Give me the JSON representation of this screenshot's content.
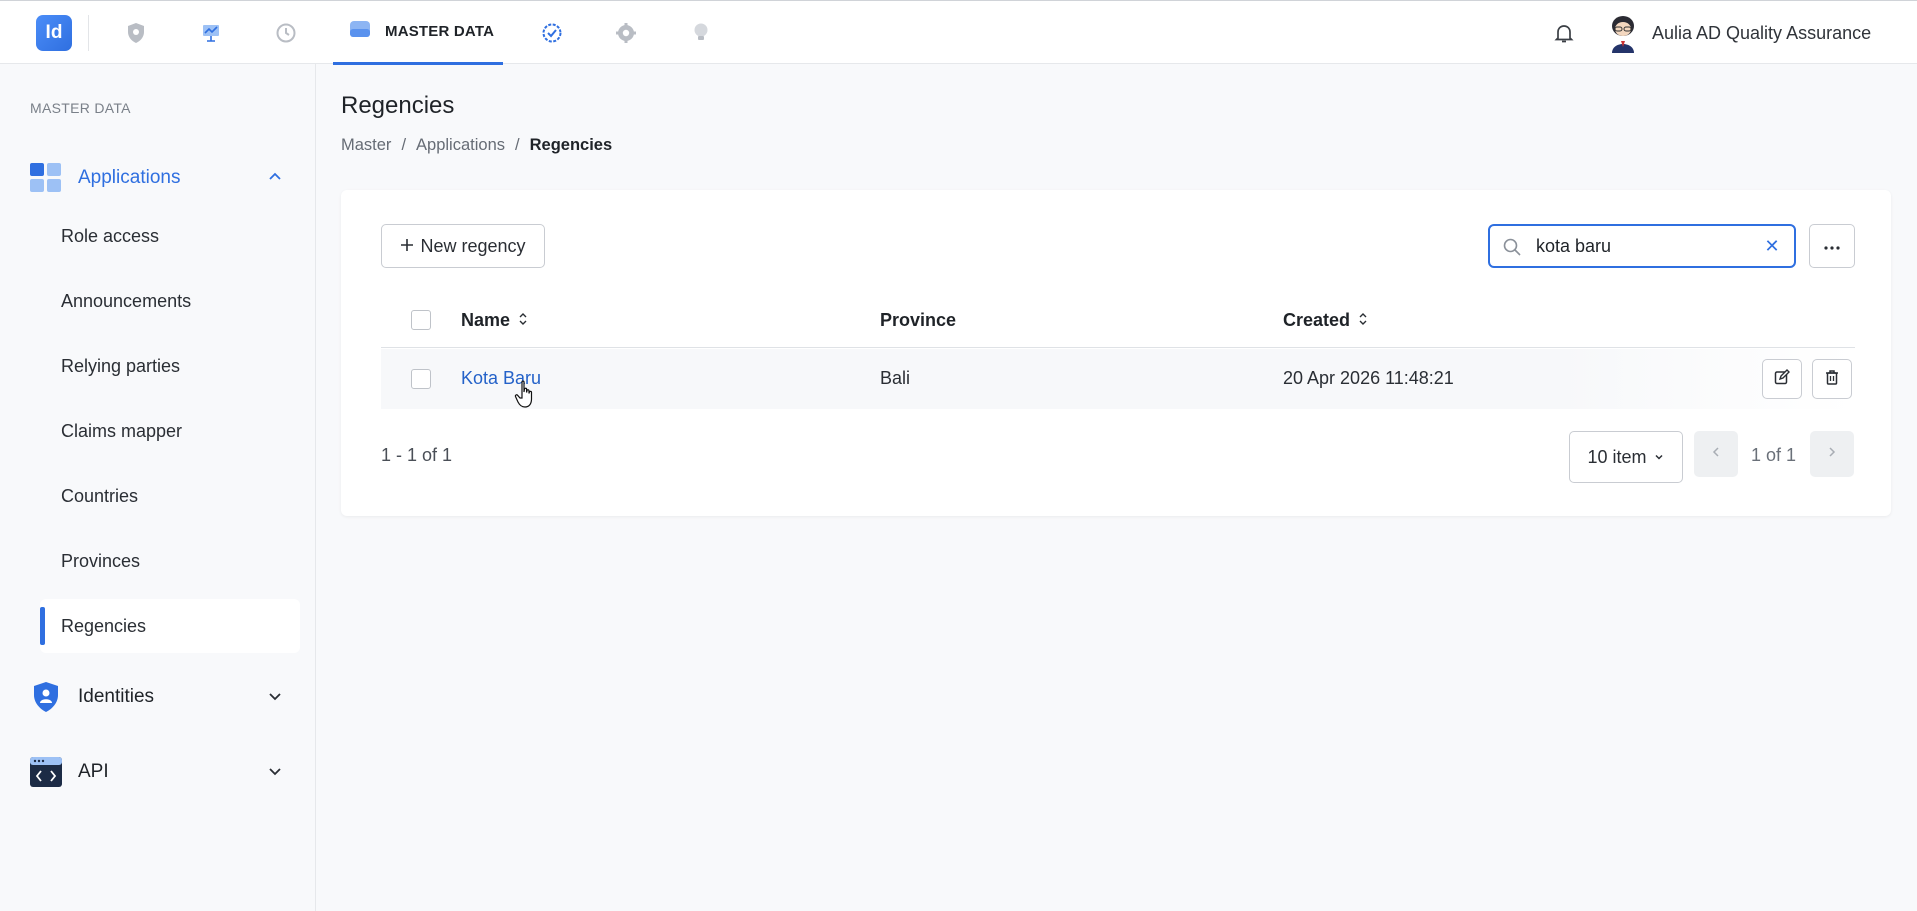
{
  "app": {
    "logo_text": "Id",
    "active_module": "MASTER DATA",
    "user_name": "Aulia AD Quality Assurance"
  },
  "topnav": {
    "icons": [
      "shield-icon",
      "dashboard-chart-icon",
      "history-clock-icon",
      "database-icon",
      "check-badge-icon",
      "gear-icon",
      "lightbulb-icon"
    ]
  },
  "sidebar": {
    "section_title": "MASTER DATA",
    "groups": [
      {
        "label": "Applications",
        "icon": "applications-grid-icon",
        "expanded": true
      },
      {
        "label": "Identities",
        "icon": "identity-shield-icon",
        "expanded": false
      },
      {
        "label": "API",
        "icon": "api-code-icon",
        "expanded": false
      }
    ],
    "items": [
      "Role access",
      "Announcements",
      "Relying parties",
      "Claims mapper",
      "Countries",
      "Provinces",
      "Regencies"
    ],
    "active_item": "Regencies"
  },
  "page": {
    "title": "Regencies",
    "breadcrumb": [
      "Master",
      "Applications",
      "Regencies"
    ]
  },
  "toolbar": {
    "new_label": "New regency",
    "search_value": "kota baru"
  },
  "table": {
    "headers": {
      "name": "Name",
      "province": "Province",
      "created": "Created"
    },
    "rows": [
      {
        "name": "Kota Baru",
        "province": "Bali",
        "created": "20 Apr 2026 11:48:21"
      }
    ]
  },
  "pagination": {
    "range_text": "1 - 1 of 1",
    "per_page": "10 item",
    "page_text": "1 of 1"
  },
  "colors": {
    "accent": "#2f6fe0",
    "link": "#2462c9"
  }
}
